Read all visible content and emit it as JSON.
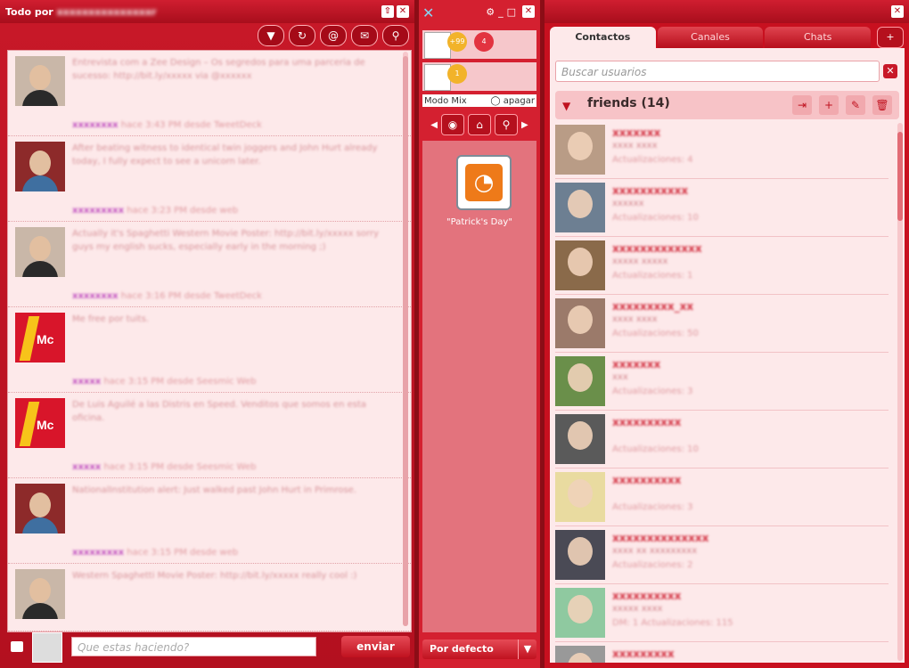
{
  "left_panel": {
    "title": "Todo por",
    "title_user_blurred": "xxxxxxxxxxxxxxxr",
    "toolbar_icons": [
      "filter-icon",
      "refresh-icon",
      "mention-icon",
      "speech-bubble-icon",
      "search-bubble-icon"
    ],
    "posts": [
      {
        "avatar": "face",
        "text": "Entrevista com a Zee Design – Os segredos para uma parceria de sucesso: http://bit.ly/xxxxx via @xxxxxx",
        "author": "xxxxxxxx",
        "meta": "hace 3:43 PM desde TweetDeck"
      },
      {
        "avatar": "face2",
        "text": "After beating witness to identical twin joggers and John Hurt already today, I fully expect to see a unicorn later.",
        "author": "xxxxxxxxx",
        "meta": "hace 3:23 PM desde web"
      },
      {
        "avatar": "face",
        "text": "Actually it's Spaghetti Western Movie Poster: http://bit.ly/xxxxx sorry guys my english sucks, especially early in the morning ;)",
        "author": "xxxxxxxx",
        "meta": "hace 3:16 PM desde TweetDeck"
      },
      {
        "avatar": "mc",
        "text": "Me free por tuits.",
        "author": "xxxxx",
        "meta": "hace 3:15 PM desde Seesmic Web"
      },
      {
        "avatar": "mc",
        "text": "De Luis Aguilé a las Distris en Speed. Venditos que somos en esta oficina.",
        "author": "xxxxx",
        "meta": "hace 3:15 PM desde Seesmic Web"
      },
      {
        "avatar": "face2",
        "text": "NationalInstitution alert: Just walked past John Hurt in Primrose.",
        "author": "xxxxxxxxx",
        "meta": "hace 3:15 PM desde web"
      },
      {
        "avatar": "face",
        "text": "Western Spaghetti Movie Poster: http://bit.ly/xxxxx really cool :)",
        "author": "",
        "meta": ""
      }
    ],
    "status_placeholder": "Que estas haciendo?",
    "send_label": "enviar"
  },
  "mid_panel": {
    "mix_label": "Modo Mix",
    "off_label": "apagar",
    "rss_label": "\"Patrick's Day\"",
    "default_label": "Por defecto",
    "hearts": [
      "+99",
      "4",
      "1"
    ]
  },
  "right_panel": {
    "tabs": [
      "Contactos",
      "Canales",
      "Chats"
    ],
    "search_placeholder": "Buscar usuarios",
    "group_title": "friends (14)",
    "contacts": [
      {
        "name": "xxxxxxx",
        "sub": "xxxx xxxx",
        "info": "Actualizaciones: 4"
      },
      {
        "name": "xxxxxxxxxxx",
        "sub": "xxxxxx",
        "info": "Actualizaciones: 10"
      },
      {
        "name": "xxxxxxxxxxxxx",
        "sub": "xxxxx xxxxx",
        "info": "Actualizaciones: 1"
      },
      {
        "name": "xxxxxxxxx_xx",
        "sub": "xxxx xxxx",
        "info": "Actualizaciones: 50"
      },
      {
        "name": "xxxxxxx",
        "sub": "xxx",
        "info": "Actualizaciones: 3"
      },
      {
        "name": "xxxxxxxxxx",
        "sub": "",
        "info": "Actualizaciones: 10"
      },
      {
        "name": "xxxxxxxxxx",
        "sub": "",
        "info": "Actualizaciones: 3"
      },
      {
        "name": "xxxxxxxxxxxxxx",
        "sub": "xxxx xx xxxxxxxxx",
        "info": "Actualizaciones: 2"
      },
      {
        "name": "xxxxxxxxxx",
        "sub": "xxxxx xxxx",
        "info": "DM: 1 Actualizaciones: 115"
      },
      {
        "name": "xxxxxxxxx",
        "sub": "",
        "info": ""
      }
    ]
  },
  "colors": {
    "brand": "#c8101f",
    "panel_bg": "#fde9ea",
    "accent_purple": "#c04fc0"
  }
}
